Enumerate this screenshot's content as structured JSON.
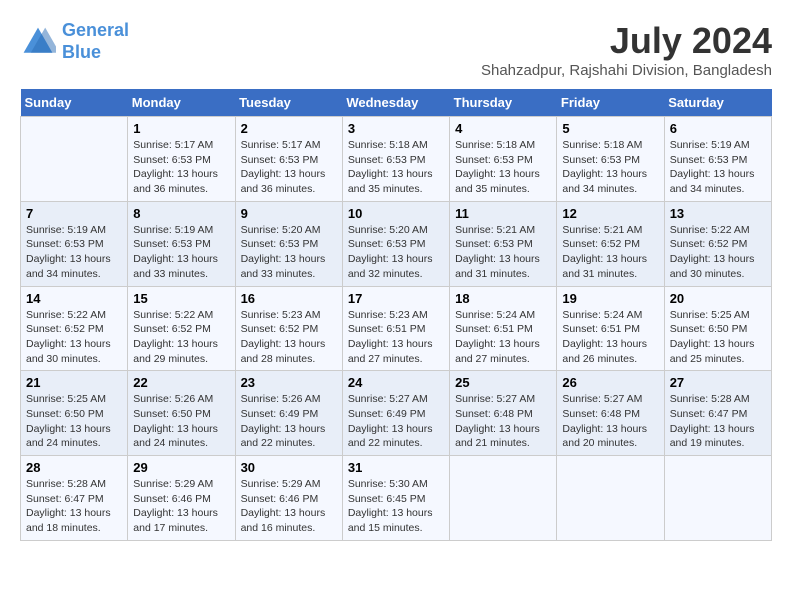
{
  "header": {
    "logo_line1": "General",
    "logo_line2": "Blue",
    "month_year": "July 2024",
    "location": "Shahzadpur, Rajshahi Division, Bangladesh"
  },
  "weekdays": [
    "Sunday",
    "Monday",
    "Tuesday",
    "Wednesday",
    "Thursday",
    "Friday",
    "Saturday"
  ],
  "weeks": [
    [
      {
        "day": "",
        "info": ""
      },
      {
        "day": "1",
        "info": "Sunrise: 5:17 AM\nSunset: 6:53 PM\nDaylight: 13 hours\nand 36 minutes."
      },
      {
        "day": "2",
        "info": "Sunrise: 5:17 AM\nSunset: 6:53 PM\nDaylight: 13 hours\nand 36 minutes."
      },
      {
        "day": "3",
        "info": "Sunrise: 5:18 AM\nSunset: 6:53 PM\nDaylight: 13 hours\nand 35 minutes."
      },
      {
        "day": "4",
        "info": "Sunrise: 5:18 AM\nSunset: 6:53 PM\nDaylight: 13 hours\nand 35 minutes."
      },
      {
        "day": "5",
        "info": "Sunrise: 5:18 AM\nSunset: 6:53 PM\nDaylight: 13 hours\nand 34 minutes."
      },
      {
        "day": "6",
        "info": "Sunrise: 5:19 AM\nSunset: 6:53 PM\nDaylight: 13 hours\nand 34 minutes."
      }
    ],
    [
      {
        "day": "7",
        "info": "Sunrise: 5:19 AM\nSunset: 6:53 PM\nDaylight: 13 hours\nand 34 minutes."
      },
      {
        "day": "8",
        "info": "Sunrise: 5:19 AM\nSunset: 6:53 PM\nDaylight: 13 hours\nand 33 minutes."
      },
      {
        "day": "9",
        "info": "Sunrise: 5:20 AM\nSunset: 6:53 PM\nDaylight: 13 hours\nand 33 minutes."
      },
      {
        "day": "10",
        "info": "Sunrise: 5:20 AM\nSunset: 6:53 PM\nDaylight: 13 hours\nand 32 minutes."
      },
      {
        "day": "11",
        "info": "Sunrise: 5:21 AM\nSunset: 6:53 PM\nDaylight: 13 hours\nand 31 minutes."
      },
      {
        "day": "12",
        "info": "Sunrise: 5:21 AM\nSunset: 6:52 PM\nDaylight: 13 hours\nand 31 minutes."
      },
      {
        "day": "13",
        "info": "Sunrise: 5:22 AM\nSunset: 6:52 PM\nDaylight: 13 hours\nand 30 minutes."
      }
    ],
    [
      {
        "day": "14",
        "info": "Sunrise: 5:22 AM\nSunset: 6:52 PM\nDaylight: 13 hours\nand 30 minutes."
      },
      {
        "day": "15",
        "info": "Sunrise: 5:22 AM\nSunset: 6:52 PM\nDaylight: 13 hours\nand 29 minutes."
      },
      {
        "day": "16",
        "info": "Sunrise: 5:23 AM\nSunset: 6:52 PM\nDaylight: 13 hours\nand 28 minutes."
      },
      {
        "day": "17",
        "info": "Sunrise: 5:23 AM\nSunset: 6:51 PM\nDaylight: 13 hours\nand 27 minutes."
      },
      {
        "day": "18",
        "info": "Sunrise: 5:24 AM\nSunset: 6:51 PM\nDaylight: 13 hours\nand 27 minutes."
      },
      {
        "day": "19",
        "info": "Sunrise: 5:24 AM\nSunset: 6:51 PM\nDaylight: 13 hours\nand 26 minutes."
      },
      {
        "day": "20",
        "info": "Sunrise: 5:25 AM\nSunset: 6:50 PM\nDaylight: 13 hours\nand 25 minutes."
      }
    ],
    [
      {
        "day": "21",
        "info": "Sunrise: 5:25 AM\nSunset: 6:50 PM\nDaylight: 13 hours\nand 24 minutes."
      },
      {
        "day": "22",
        "info": "Sunrise: 5:26 AM\nSunset: 6:50 PM\nDaylight: 13 hours\nand 24 minutes."
      },
      {
        "day": "23",
        "info": "Sunrise: 5:26 AM\nSunset: 6:49 PM\nDaylight: 13 hours\nand 22 minutes."
      },
      {
        "day": "24",
        "info": "Sunrise: 5:27 AM\nSunset: 6:49 PM\nDaylight: 13 hours\nand 22 minutes."
      },
      {
        "day": "25",
        "info": "Sunrise: 5:27 AM\nSunset: 6:48 PM\nDaylight: 13 hours\nand 21 minutes."
      },
      {
        "day": "26",
        "info": "Sunrise: 5:27 AM\nSunset: 6:48 PM\nDaylight: 13 hours\nand 20 minutes."
      },
      {
        "day": "27",
        "info": "Sunrise: 5:28 AM\nSunset: 6:47 PM\nDaylight: 13 hours\nand 19 minutes."
      }
    ],
    [
      {
        "day": "28",
        "info": "Sunrise: 5:28 AM\nSunset: 6:47 PM\nDaylight: 13 hours\nand 18 minutes."
      },
      {
        "day": "29",
        "info": "Sunrise: 5:29 AM\nSunset: 6:46 PM\nDaylight: 13 hours\nand 17 minutes."
      },
      {
        "day": "30",
        "info": "Sunrise: 5:29 AM\nSunset: 6:46 PM\nDaylight: 13 hours\nand 16 minutes."
      },
      {
        "day": "31",
        "info": "Sunrise: 5:30 AM\nSunset: 6:45 PM\nDaylight: 13 hours\nand 15 minutes."
      },
      {
        "day": "",
        "info": ""
      },
      {
        "day": "",
        "info": ""
      },
      {
        "day": "",
        "info": ""
      }
    ]
  ]
}
